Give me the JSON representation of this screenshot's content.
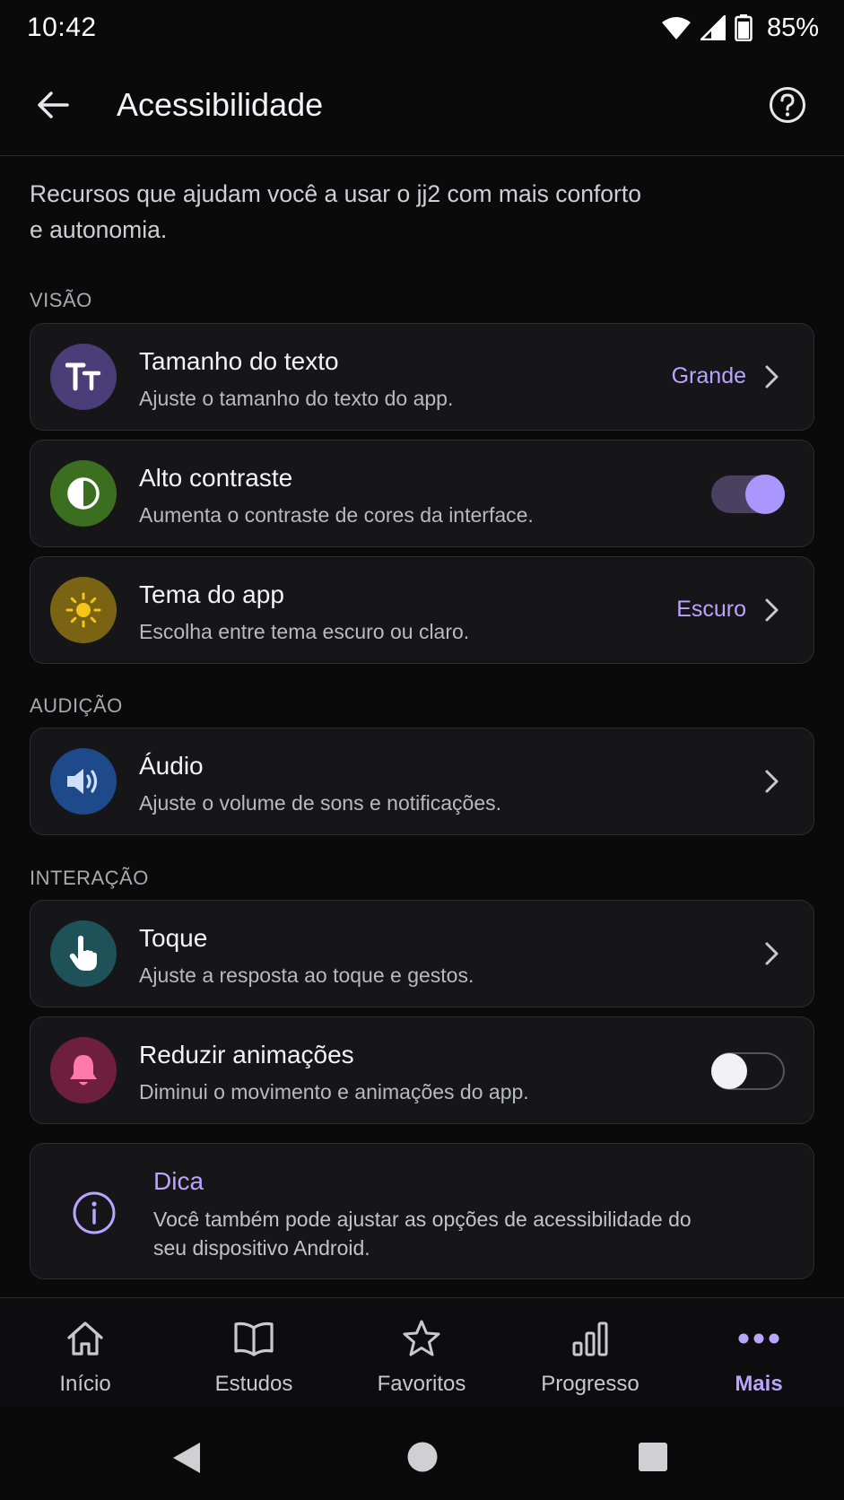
{
  "status_bar": {
    "time": "10:42",
    "battery": "85%"
  },
  "app_bar": {
    "title": "Acessibilidade"
  },
  "intro": "Recursos que ajudam você a usar o jj2 com mais conforto e autonomia.",
  "sections": {
    "vision": "VISÃO",
    "hearing": "AUDIÇÃO",
    "interaction": "INTERAÇÃO"
  },
  "items": {
    "text_size": {
      "title": "Tamanho do texto",
      "subtitle": "Ajuste o tamanho do texto do app.",
      "value": "Grande",
      "icon": "text-size-icon"
    },
    "high_contrast": {
      "title": "Alto contraste",
      "subtitle": "Aumenta o contraste de cores da interface.",
      "enabled": true,
      "icon": "contrast-icon"
    },
    "theme": {
      "title": "Tema do app",
      "subtitle": "Escolha entre tema escuro ou claro.",
      "value": "Escuro",
      "icon": "sun-icon"
    },
    "audio": {
      "title": "Áudio",
      "subtitle": "Ajuste o volume de sons e notificações.",
      "icon": "speaker-icon"
    },
    "touch": {
      "title": "Toque",
      "subtitle": "Ajuste a resposta ao toque e gestos.",
      "icon": "hand-pointer-icon"
    },
    "reduce_motion": {
      "title": "Reduzir animações",
      "subtitle": "Diminui o movimento e animações do app.",
      "enabled": false,
      "icon": "bell-icon"
    }
  },
  "tip": {
    "title": "Dica",
    "text": "Você também pode ajustar as opções de acessibilidade do seu dispositivo Android."
  },
  "bottom_nav": [
    {
      "label": "Início",
      "icon": "home-icon",
      "active": false
    },
    {
      "label": "Estudos",
      "icon": "book-icon",
      "active": false
    },
    {
      "label": "Favoritos",
      "icon": "star-icon",
      "active": false
    },
    {
      "label": "Progresso",
      "icon": "bar-chart-icon",
      "active": false
    },
    {
      "label": "Mais",
      "icon": "more-dots-icon",
      "active": true
    }
  ],
  "colors": {
    "accent": "#b9a4ff",
    "background": "#0a0a0a",
    "card": "#161618"
  }
}
